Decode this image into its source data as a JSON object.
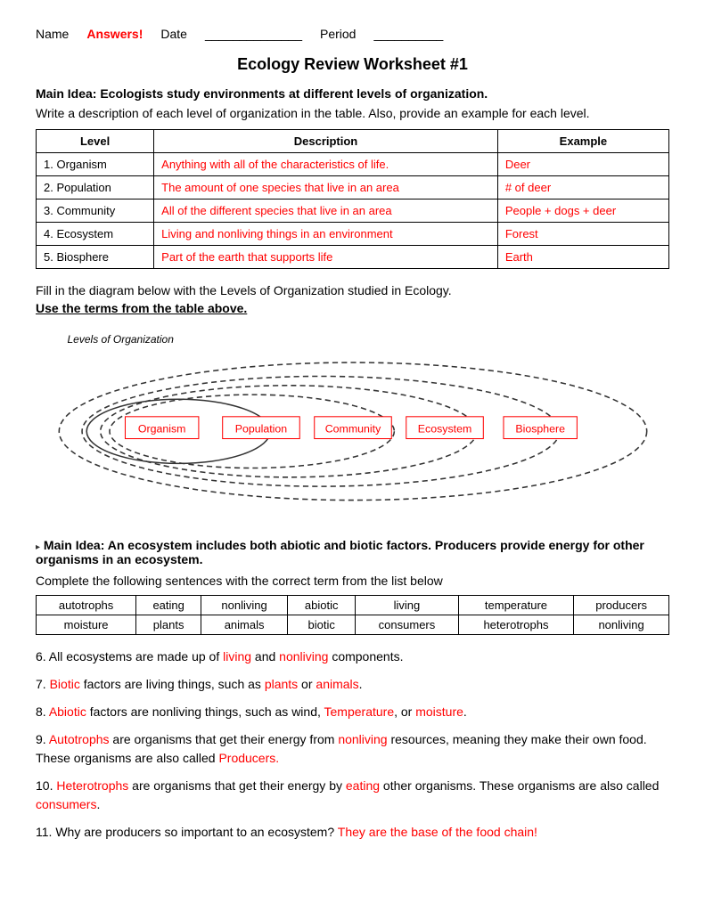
{
  "header": {
    "name_label": "Name",
    "answers_label": "Answers!",
    "date_label": "Date",
    "date_blank": "______________",
    "period_label": "Period",
    "period_blank": "__________"
  },
  "title": "Ecology Review Worksheet #1",
  "section1": {
    "main_idea": "Main Idea:  Ecologists study environments at different levels of organization.",
    "sub_text": "Write a description of each level of organization in the table.  Also, provide an example for each level.",
    "table": {
      "headers": [
        "Level",
        "Description",
        "Example"
      ],
      "rows": [
        {
          "level": "1. Organism",
          "description": "Anything with all of the characteristics of life.",
          "example": "Deer"
        },
        {
          "level": "2. Population",
          "description": "The amount of one species that live in an area",
          "example": "# of deer"
        },
        {
          "level": "3. Community",
          "description": "All of the different species that live in an area",
          "example": "People + dogs  + deer"
        },
        {
          "level": "4. Ecosystem",
          "description": "Living and nonliving things in an environment",
          "example": "Forest"
        },
        {
          "level": "5. Biosphere",
          "description": "Part of the earth that supports life",
          "example": "Earth"
        }
      ]
    }
  },
  "diagram": {
    "instruction": "Fill in the diagram below with the Levels of Organization studied in Ecology.",
    "use_terms": "Use the terms from the table above.",
    "title": "Levels of Organization",
    "labels": [
      "Organism",
      "Population",
      "Community",
      "Ecosystem",
      "Biosphere"
    ]
  },
  "section2": {
    "main_idea": "Main Idea:  An ecosystem includes both abiotic and biotic factors.  Producers provide energy for other organisms in an ecosystem.",
    "complete_text": "Complete the following sentences with the correct term from the list below",
    "word_bank": [
      [
        "autotrophs",
        "eating",
        "nonliving",
        "abiotic",
        "living",
        "temperature",
        "producers"
      ],
      [
        "moisture",
        "plants",
        "animals",
        "biotic",
        "consumers",
        "heterotrophs",
        "nonliving"
      ]
    ],
    "sentences": [
      {
        "num": "6.",
        "parts": [
          {
            "text": " All ecosystems are made up of ",
            "color": "black"
          },
          {
            "text": "living",
            "color": "red"
          },
          {
            "text": " and ",
            "color": "black"
          },
          {
            "text": "nonliving",
            "color": "red"
          },
          {
            "text": " components.",
            "color": "black"
          }
        ]
      },
      {
        "num": "7.",
        "parts": [
          {
            "text": " ",
            "color": "black"
          },
          {
            "text": "Biotic",
            "color": "red"
          },
          {
            "text": " factors are living things, such as ",
            "color": "black"
          },
          {
            "text": "plants",
            "color": "red"
          },
          {
            "text": " or ",
            "color": "black"
          },
          {
            "text": "animals",
            "color": "red"
          },
          {
            "text": ".",
            "color": "black"
          }
        ]
      },
      {
        "num": "8.",
        "parts": [
          {
            "text": " ",
            "color": "black"
          },
          {
            "text": "Abiotic",
            "color": "red"
          },
          {
            "text": " factors are nonliving things, such as wind, ",
            "color": "black"
          },
          {
            "text": "Temperature",
            "color": "red"
          },
          {
            "text": ", or ",
            "color": "black"
          },
          {
            "text": "moisture",
            "color": "red"
          },
          {
            "text": ".",
            "color": "black"
          }
        ]
      },
      {
        "num": "9.",
        "parts": [
          {
            "text": " ",
            "color": "black"
          },
          {
            "text": "Autotrophs",
            "color": "red"
          },
          {
            "text": " are organisms that get their energy from ",
            "color": "black"
          },
          {
            "text": "nonliving",
            "color": "red"
          },
          {
            "text": " resources, meaning they make their own food.  These organisms are also called ",
            "color": "black"
          },
          {
            "text": "Producers.",
            "color": "red"
          }
        ]
      },
      {
        "num": "10.",
        "parts": [
          {
            "text": " ",
            "color": "black"
          },
          {
            "text": "Heterotrophs",
            "color": "red"
          },
          {
            "text": " are organisms that get their energy by ",
            "color": "black"
          },
          {
            "text": "eating",
            "color": "red"
          },
          {
            "text": " other organisms.  These organisms are also called ",
            "color": "black"
          },
          {
            "text": "consumers",
            "color": "red"
          },
          {
            "text": ".",
            "color": "black"
          }
        ]
      },
      {
        "num": "11.",
        "parts": [
          {
            "text": " Why are producers so important to an ecosystem? ",
            "color": "black"
          },
          {
            "text": "They are the base of the food chain!",
            "color": "red"
          }
        ]
      }
    ]
  }
}
